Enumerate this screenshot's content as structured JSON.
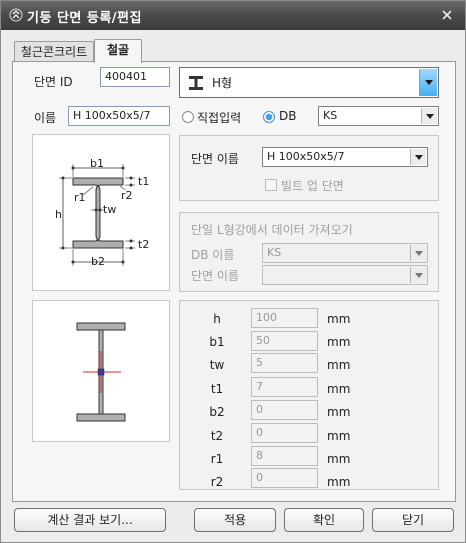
{
  "window": {
    "title": "기둥 단면 등록/편집"
  },
  "tabs": [
    {
      "label": "철근콘크리트",
      "active": false
    },
    {
      "label": "철골",
      "active": true
    }
  ],
  "section_id": {
    "label": "단면 ID",
    "value": "400401"
  },
  "shape_select": {
    "value": "H형",
    "icon": "h-beam-icon"
  },
  "name": {
    "label": "이름",
    "value": "H 100x50x5/7"
  },
  "source": {
    "direct_input_label": "직접입력",
    "db_label": "DB",
    "selected": "DB",
    "db_select_value": "KS"
  },
  "section_name": {
    "label": "단면 이름",
    "value": "H 100x50x5/7"
  },
  "builtup": {
    "label": "빌트 업 단면",
    "checked": false
  },
  "import_group": {
    "title": "단일 L형강에서 데이터 가져오기",
    "db_name_label": "DB 이름",
    "db_name_value": "KS",
    "section_name_label": "단면 이름",
    "section_name_value": ""
  },
  "diagram_labels": {
    "b1": "b1",
    "t1": "t1",
    "r1": "r1",
    "r2": "r2",
    "h": "h",
    "tw": "tw",
    "t2": "t2",
    "b2": "b2"
  },
  "dimensions": [
    {
      "label": "h",
      "value": "100",
      "unit": "mm"
    },
    {
      "label": "b1",
      "value": "50",
      "unit": "mm"
    },
    {
      "label": "tw",
      "value": "5",
      "unit": "mm"
    },
    {
      "label": "t1",
      "value": "7",
      "unit": "mm"
    },
    {
      "label": "b2",
      "value": "0",
      "unit": "mm"
    },
    {
      "label": "t2",
      "value": "0",
      "unit": "mm"
    },
    {
      "label": "r1",
      "value": "8",
      "unit": "mm"
    },
    {
      "label": "r2",
      "value": "0",
      "unit": "mm"
    }
  ],
  "buttons": {
    "calc_result": "계산 결과 보기...",
    "apply": "적용",
    "ok": "확인",
    "close": "닫기"
  },
  "colors": {
    "accent": "#3da3ef",
    "titlebar": "#4a4a4a",
    "centroid": "#e0202a"
  }
}
